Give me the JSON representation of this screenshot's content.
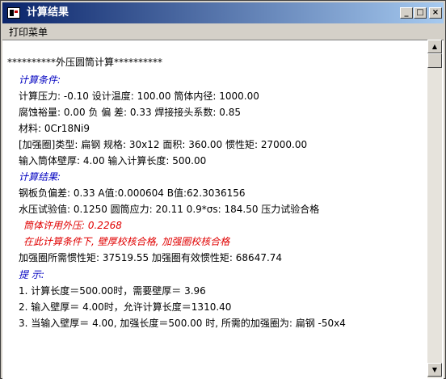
{
  "window": {
    "title": "计算结果",
    "controls": {
      "minimize": "_",
      "maximize": "□",
      "close": "×"
    }
  },
  "menu": {
    "print": "打印菜单"
  },
  "report": {
    "header": "**********外压圆筒计算**********",
    "conditions_heading": "计算条件:",
    "cond_line1": "计算压力: -0.10     设计温度: 100.00      筒体内径: 1000.00",
    "cond_line2": "腐蚀裕量: 0.00      负 偏 差:  0.33     焊接接头系数: 0.85",
    "cond_line3": "材料: 0Cr18Ni9",
    "cond_line4": "[加强圈]类型: 扁钢   规格: 30x12   面积: 360.00   惯性矩: 27000.00",
    "cond_line5": "输入筒体壁厚:  4.00    输入计算长度:  500.00",
    "results_heading": "计算结果:",
    "res_line1": "钢板负偏差:  0.33    A值:0.000604    B值:62.3036156",
    "res_line2": "水压试验值:  0.1250   圆筒应力: 20.11   0.9*σs: 184.50   压力试验合格",
    "res_line3": "筒体许用外压:  0.2268",
    "res_line4": "在此计算条件下, 壁厚校核合格, 加强圈校核合格",
    "res_line5": "加强圈所需惯性矩:    37519.55     加强圈有效惯性矩:  68647.74",
    "hints_heading": "提  示:",
    "hint1": "1. 计算长度＝500.00时，需要壁厚＝ 3.96",
    "hint2": "2. 输入壁厚＝ 4.00时，允许计算长度＝1310.40",
    "hint3": "3. 当输入壁厚＝ 4.00, 加强长度＝500.00 时, 所需的加强圈为: 扁钢  -50x4"
  },
  "colors": {
    "title_gradient_start": "#0a246a",
    "title_gradient_end": "#a6caf0",
    "heading_blue": "#0000c0",
    "highlight_red": "#e00000"
  },
  "icons": {
    "app": "document-app-icon",
    "scroll_up": "arrow-up-icon",
    "scroll_down": "arrow-down-icon"
  }
}
